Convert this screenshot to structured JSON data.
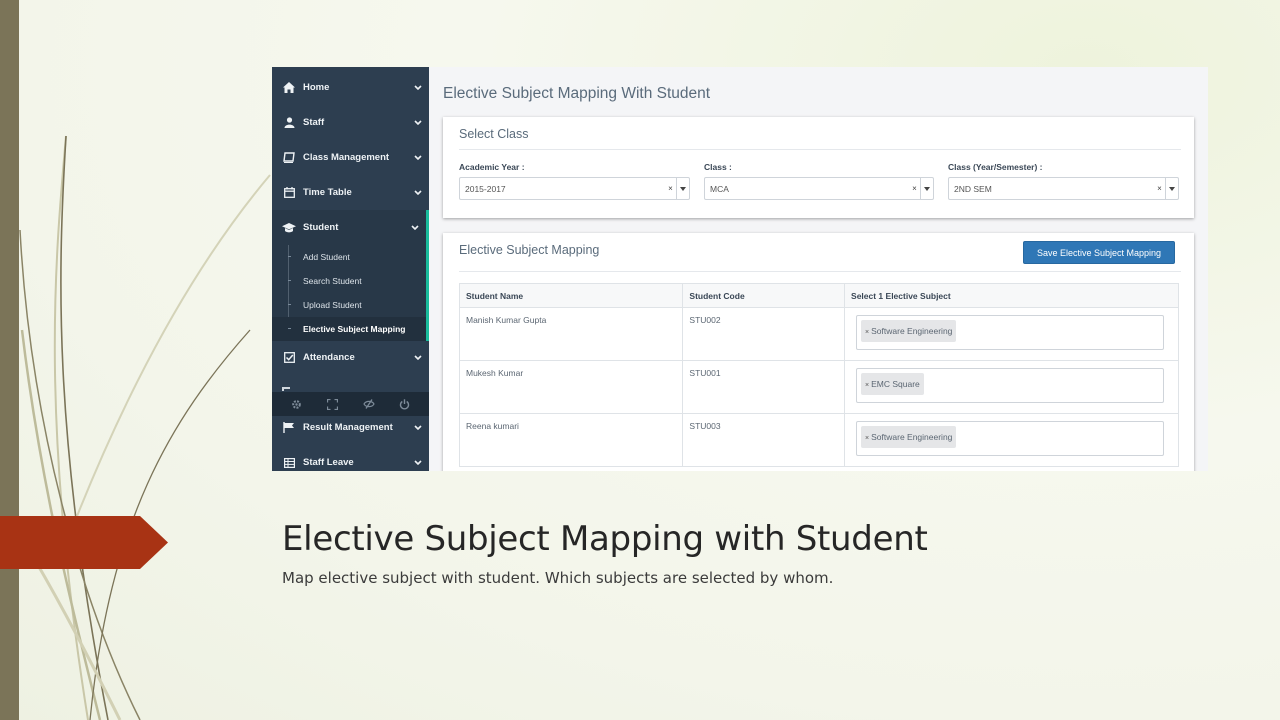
{
  "slide": {
    "title": "Elective Subject Mapping with Student",
    "subtitle": "Map elective subject with student. Which subjects are selected by whom.",
    "colors": {
      "left_bar": "#7b7458",
      "arrow": "#a83314",
      "background": "#f3f5ea"
    }
  },
  "sidebar": {
    "items": [
      {
        "label": "Home",
        "icon": "home-icon"
      },
      {
        "label": "Staff",
        "icon": "user-icon"
      },
      {
        "label": "Class Management",
        "icon": "book-icon"
      },
      {
        "label": "Time Table",
        "icon": "calendar-icon"
      },
      {
        "label": "Student",
        "icon": "graduation-cap-icon"
      },
      {
        "label": "Attendance",
        "icon": "checkbox-icon"
      },
      {
        "label": "Result Management",
        "icon": "flag-icon"
      },
      {
        "label": "Staff Leave",
        "icon": "table-icon"
      }
    ],
    "submenu": [
      {
        "label": "Add Student"
      },
      {
        "label": "Search Student"
      },
      {
        "label": "Upload Student"
      },
      {
        "label": "Elective Subject Mapping"
      }
    ],
    "toolbar_icons": [
      "gear-icon",
      "fullscreen-icon",
      "eye-slash-icon",
      "power-icon"
    ],
    "colors": {
      "background": "#2d3e50",
      "active_accent": "#1abc9c"
    }
  },
  "main": {
    "page_title": "Elective Subject Mapping With Student",
    "select_class": {
      "heading": "Select Class",
      "fields": [
        {
          "label": "Academic Year :",
          "value": "2015-2017"
        },
        {
          "label": "Class :",
          "value": "MCA"
        },
        {
          "label": "Class (Year/Semester) :",
          "value": "2ND SEM"
        }
      ]
    },
    "mapping": {
      "heading": "Elective Subject Mapping",
      "save_label": "Save Elective Subject Mapping",
      "columns": [
        "Student Name",
        "Student Code",
        "Select 1 Elective Subject"
      ],
      "rows": [
        {
          "name": "Manish Kumar Gupta",
          "code": "STU002",
          "subject": "Software Engineering"
        },
        {
          "name": "Mukesh Kumar",
          "code": "STU001",
          "subject": "EMC Square"
        },
        {
          "name": "Reena kumari",
          "code": "STU003",
          "subject": "Software Engineering"
        }
      ],
      "tag_remove_glyph": "×",
      "accent_color": "#2f77b6"
    }
  }
}
